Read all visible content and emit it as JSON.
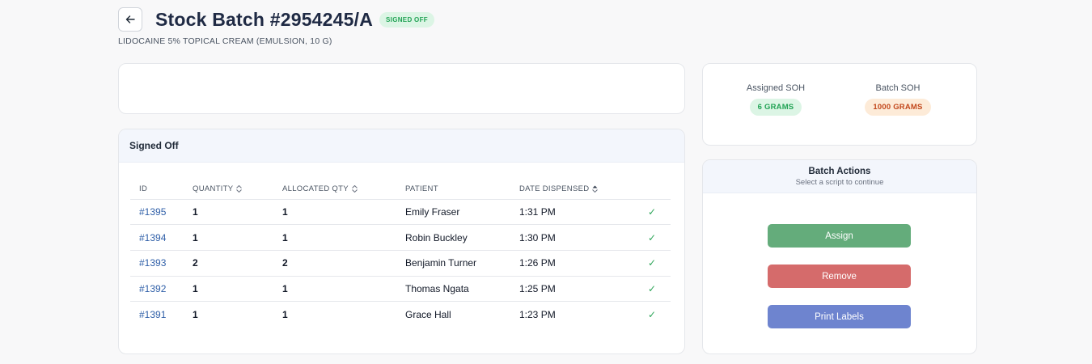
{
  "header": {
    "title": "Stock Batch #2954245/A",
    "status": "SIGNED OFF",
    "subtitle": "LIDOCAINE 5% TOPICAL CREAM (EMULSION, 10 G)"
  },
  "signed_off": {
    "title": "Signed Off",
    "columns": [
      "ID",
      "QUANTITY",
      "ALLOCATED QTY",
      "PATIENT",
      "DATE DISPENSED"
    ],
    "rows": [
      {
        "id": "#1395",
        "quantity": "1",
        "allocated": "1",
        "patient": "Emily Fraser",
        "date": "1:31 PM",
        "check": "✓"
      },
      {
        "id": "#1394",
        "quantity": "1",
        "allocated": "1",
        "patient": "Robin Buckley",
        "date": "1:30 PM",
        "check": "✓"
      },
      {
        "id": "#1393",
        "quantity": "2",
        "allocated": "2",
        "patient": "Benjamin Turner",
        "date": "1:26 PM",
        "check": "✓"
      },
      {
        "id": "#1392",
        "quantity": "1",
        "allocated": "1",
        "patient": "Thomas Ngata",
        "date": "1:25 PM",
        "check": "✓"
      },
      {
        "id": "#1391",
        "quantity": "1",
        "allocated": "1",
        "patient": "Grace Hall",
        "date": "1:23 PM",
        "check": "✓"
      }
    ]
  },
  "soh": {
    "assigned_label": "Assigned SOH",
    "assigned_value": "6 GRAMS",
    "batch_label": "Batch SOH",
    "batch_value": "1000 GRAMS"
  },
  "actions": {
    "title": "Batch Actions",
    "subtitle": "Select a script to continue",
    "assign": "Assign",
    "remove": "Remove",
    "print": "Print Labels"
  },
  "colors": {
    "accent_green": "#64ac7b",
    "accent_red": "#d56b6b",
    "accent_blue": "#6e84cf",
    "link": "#2f5fa8"
  }
}
